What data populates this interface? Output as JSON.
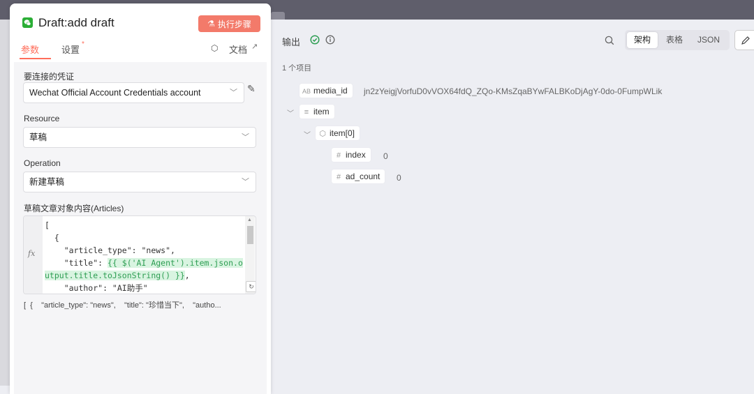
{
  "node": {
    "title": "Draft:add draft",
    "execute_label": "执行步骤",
    "tabs": {
      "params": "参数",
      "settings": "设置",
      "settings_dot": "*"
    },
    "docs_label": "文档"
  },
  "form": {
    "credential_label": "要连接的凭证",
    "credential_value": "Wechat Official Account Credentials account",
    "resource_label": "Resource",
    "resource_value": "草稿",
    "operation_label": "Operation",
    "operation_value": "新建草稿",
    "articles_label": "草稿文章对象内容(Articles)",
    "fx_label": "fx",
    "code_lines": {
      "l1": "[",
      "l2": "  {",
      "l3": "    \"article_type\": \"news\",",
      "l4a": "    \"title\": ",
      "l4b": "{{ $('AI Agent').item.json.o",
      "l5a": "utput.title.toJsonString() }}",
      "l5b": ",",
      "l6": "    \"author\": \"AI助手\""
    },
    "preview": "[  {    \"article_type\": \"news\",    \"title\": \"珍惜当下\",    \"autho..."
  },
  "output": {
    "title": "输出",
    "views": {
      "schema": "架构",
      "table": "表格",
      "json": "JSON"
    },
    "count": "1 个项目",
    "fields": {
      "media_id": {
        "name": "media_id",
        "type_icon": "AB",
        "value": "jn2zYeigjVorfuD0vVOX64fdQ_ZQo-KMsZqaBYwFALBKoDjAgY-0do-0FumpWLik"
      },
      "item": {
        "name": "item",
        "type_icon": "≡"
      },
      "item0": {
        "name": "item[0]"
      },
      "index": {
        "name": "index",
        "type_icon": "#",
        "value": "0"
      },
      "ad_count": {
        "name": "ad_count",
        "type_icon": "#",
        "value": "0"
      }
    }
  },
  "colors": {
    "accent": "#ff6d5a",
    "exec_button": "#f37a6a",
    "wechat_green": "#2bae36",
    "success": "#2e9e53"
  }
}
